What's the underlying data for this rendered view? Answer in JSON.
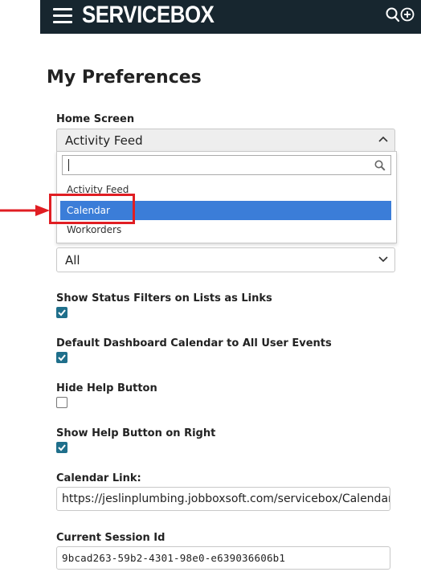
{
  "app": {
    "brand": "SERVICEBOX"
  },
  "page": {
    "title": "My Preferences"
  },
  "home_screen": {
    "label": "Home Screen",
    "selected": "Activity Feed",
    "search_value": "",
    "options": [
      "Activity Feed",
      "Calendar",
      "Workorders"
    ],
    "highlighted": "Calendar"
  },
  "second_select": {
    "value": "All"
  },
  "checkboxes": [
    {
      "label": "Show Status Filters on Lists as Links",
      "checked": true
    },
    {
      "label": "Default Dashboard Calendar to All User Events",
      "checked": true
    },
    {
      "label": "Hide Help Button",
      "checked": false
    },
    {
      "label": "Show Help Button on Right",
      "checked": true
    }
  ],
  "calendar_link": {
    "label": "Calendar Link:",
    "value": "https://jeslinplumbing.jobboxsoft.com/servicebox/Calendar"
  },
  "session": {
    "label": "Current Session Id",
    "value": "9bcad263-59b2-4301-98e0-e639036606b1"
  },
  "colors": {
    "header_bg": "#17262f",
    "selected_option": "#3b7dd8",
    "checkbox_checked": "#1f6f8b",
    "annotation_red": "#e01e23"
  },
  "icons": {
    "menu": "hamburger-menu-icon",
    "search": "search-icon",
    "add": "add-circle-icon",
    "chevron_up": "chevron-up-icon",
    "chevron_down": "chevron-down-icon",
    "magnifier": "search-icon",
    "annotation_arrow": "red-arrow-icon"
  }
}
